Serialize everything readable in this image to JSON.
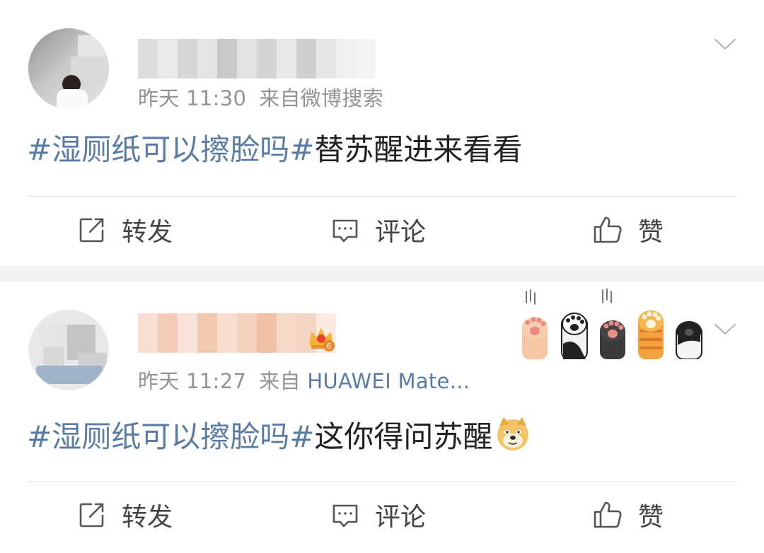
{
  "posts": [
    {
      "time": "昨天 11:30",
      "source": "来自微博搜索",
      "source_prefix": "",
      "source_device": "",
      "topic": "#湿厕纸可以擦脸吗#",
      "text": "替苏醒进来看看",
      "actions": {
        "repost": "转发",
        "comment": "评论",
        "like": "赞"
      }
    },
    {
      "time": "昨天 11:27",
      "source_prefix": "来自",
      "source_device": "HUAWEI Mate...",
      "vip_level": "6",
      "topic": "#湿厕纸可以擦脸吗#",
      "text": "这你得问苏醒",
      "actions": {
        "repost": "转发",
        "comment": "评论",
        "like": "赞"
      }
    }
  ],
  "icons": {
    "repost": "repost-icon",
    "comment": "comment-icon",
    "like": "thumbs-up-icon",
    "menu": "chevron-down-icon",
    "vip": "crown-icon",
    "emoji": "doge-emoji-icon",
    "card": "cat-paws-decoration"
  },
  "colors": {
    "topic": "#5b7ba7",
    "meta": "#939393",
    "separator": "#f2f2f2"
  }
}
